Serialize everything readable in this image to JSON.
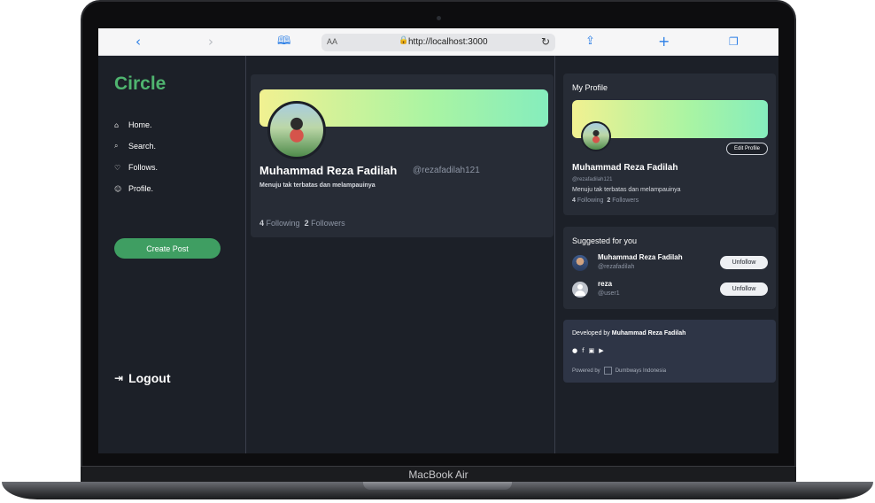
{
  "device": {
    "label": "MacBook Air"
  },
  "browser": {
    "text_size": "AA",
    "url": "http://localhost:3000",
    "icons": [
      "back-icon",
      "forward-icon",
      "bookmarks-icon",
      "lock-icon",
      "reload-icon",
      "share-icon",
      "new-tab-icon",
      "tabs-icon"
    ]
  },
  "sidebar": {
    "brand": "Circle",
    "items": [
      {
        "label": "Home.",
        "icon": "home-icon"
      },
      {
        "label": "Search.",
        "icon": "search-icon"
      },
      {
        "label": "Follows.",
        "icon": "heart-icon"
      },
      {
        "label": "Profile.",
        "icon": "user-icon"
      }
    ],
    "create_post": "Create Post",
    "logout": "Logout"
  },
  "profile": {
    "name": "Muhammad Reza Fadilah",
    "handle": "@rezafadilah121",
    "bio": "Menuju tak terbatas dan melampauinya",
    "following_count": "4",
    "following_label": "Following",
    "followers_count": "2",
    "followers_label": "Followers"
  },
  "my_profile": {
    "title": "My Profile",
    "edit_button": "Edit Profile",
    "name": "Muhammad Reza Fadilah",
    "handle": "@rezafadilah121",
    "bio": "Menuju tak terbatas dan melampauinya",
    "following_count": "4",
    "following_label": "Following",
    "followers_count": "2",
    "followers_label": "Followers"
  },
  "suggested": {
    "title": "Suggested for you",
    "users": [
      {
        "name": "Muhammad Reza Fadilah",
        "handle": "@rezafadilah",
        "button": "Unfollow"
      },
      {
        "name": "reza",
        "handle": "@user1",
        "button": "Unfollow"
      }
    ]
  },
  "footer": {
    "developed_prefix": "Developed by",
    "developer": "Muhammad Reza Fadilah",
    "socials": [
      "github-icon",
      "facebook-icon",
      "instagram-icon",
      "youtube-icon"
    ],
    "powered_prefix": "Powered by",
    "powered_name": "Dumbways Indonesia"
  },
  "colors": {
    "accent": "#4fb46f",
    "button": "#3f9e62",
    "background": "#1c2028",
    "card": "#272c36"
  }
}
